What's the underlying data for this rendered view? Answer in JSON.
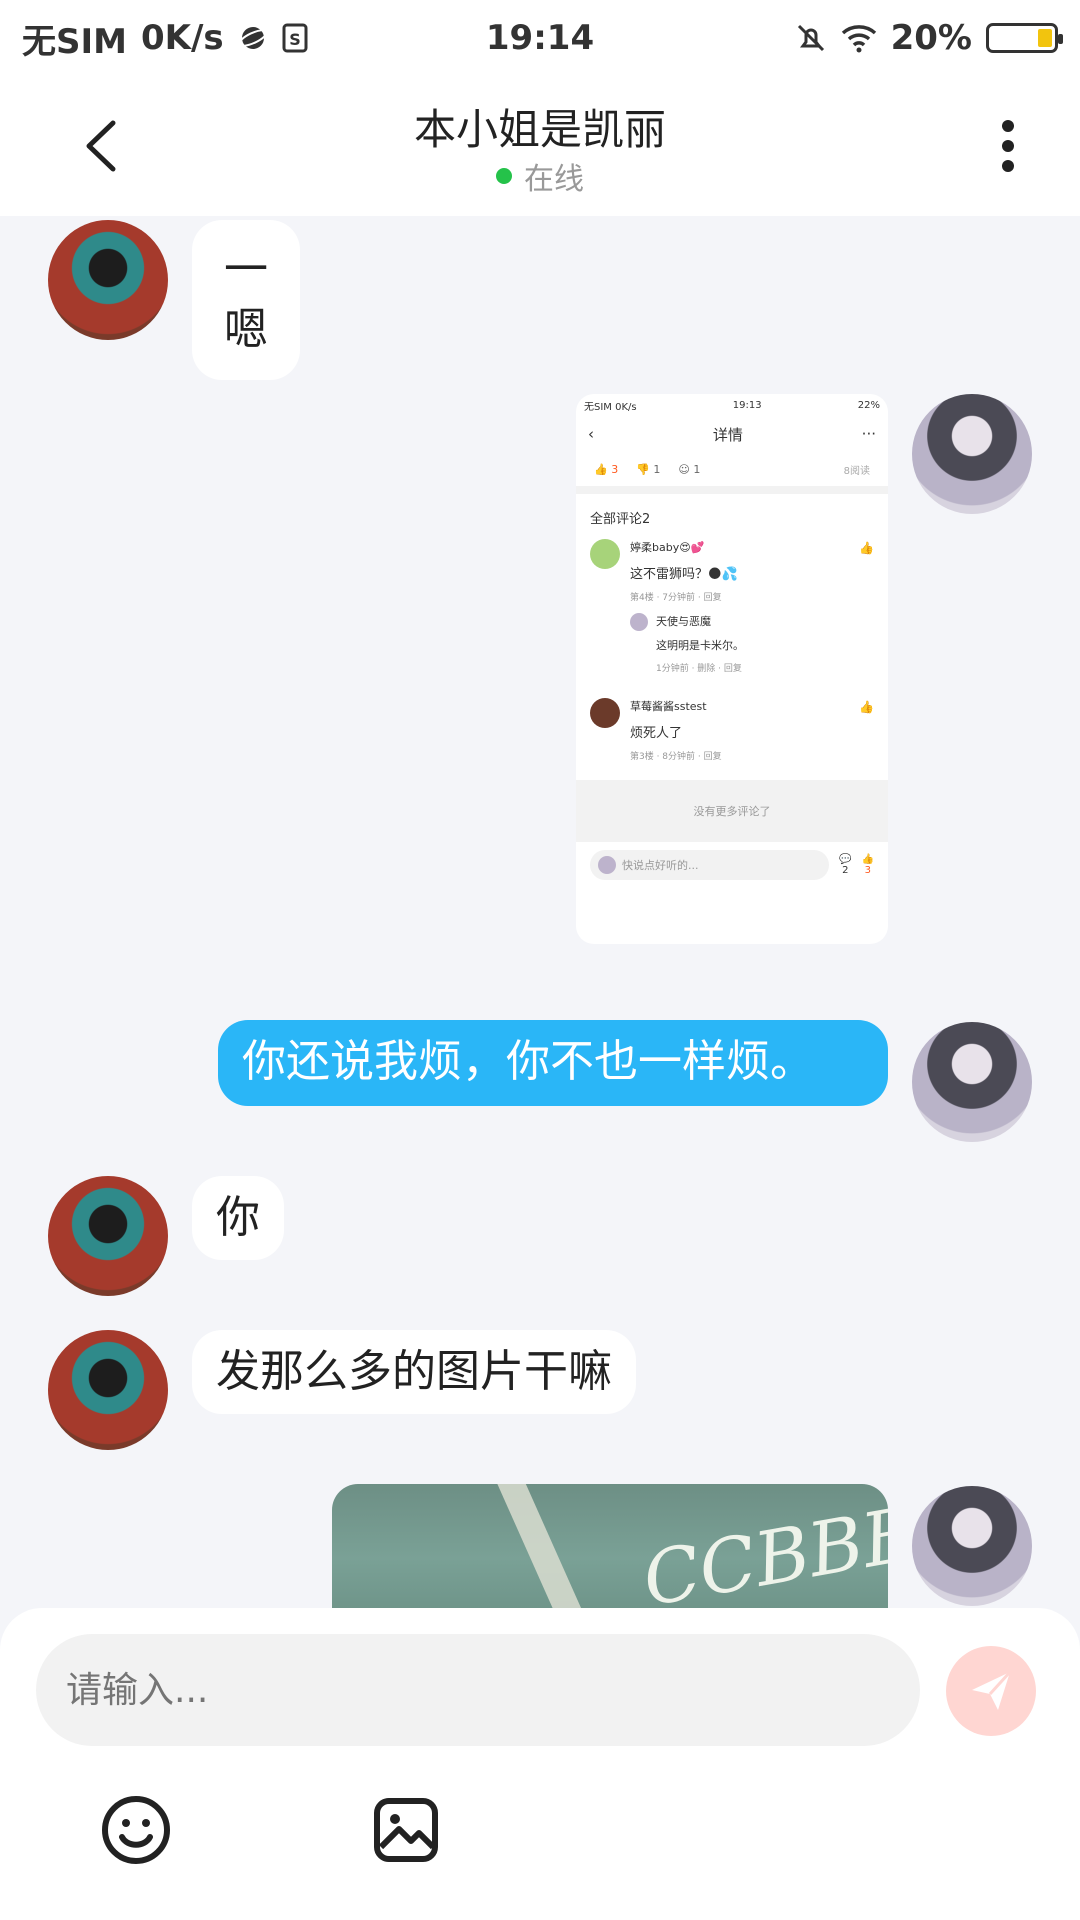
{
  "status_bar": {
    "carrier": "无SIM",
    "speed": "0K/s",
    "time": "19:14",
    "battery": "20%"
  },
  "header": {
    "title": "本小姐是凯丽",
    "status": "在线"
  },
  "messages": [
    {
      "side": "other",
      "text": "一\n嗯"
    },
    {
      "side": "me",
      "type": "image-screenshot"
    },
    {
      "side": "me",
      "text": "你还说我烦，你不也一样烦。"
    },
    {
      "side": "other",
      "text": "你"
    },
    {
      "side": "other",
      "text": "发那么多的图片干嘛"
    },
    {
      "side": "me",
      "type": "image-photo"
    }
  ],
  "screenshot": {
    "status_left": "无SIM 0K/s",
    "time": "19:13",
    "battery": "22%",
    "title": "详情",
    "likes": "3",
    "dislikes": "1",
    "emoji_count": "1",
    "reads": "8阅读",
    "section_title": "全部评论2",
    "comments": [
      {
        "name": "婷柔baby😍💕",
        "text": "这不雷狮吗？🌑💦",
        "meta": "第4楼 · 7分钟前 · 回复",
        "reply_name": "天使与恶魔",
        "reply_text": "这明明是卡米尔。",
        "reply_meta": "1分钟前 · 删除 · 回复"
      },
      {
        "name": "草莓酱酱sstest",
        "text": "烦死人了",
        "meta": "第3楼 · 8分钟前 · 回复"
      }
    ],
    "no_more": "没有更多评论了",
    "input_placeholder": "快说点好听的...",
    "comment_count": "2",
    "like_count": "3"
  },
  "photo": {
    "chalk_text": "CCBBB"
  },
  "composer": {
    "placeholder": "请输入..."
  },
  "colors": {
    "accent_blue": "#2ab6f7",
    "online_green": "#25c24a",
    "send_disabled": "#ffd6d2"
  }
}
